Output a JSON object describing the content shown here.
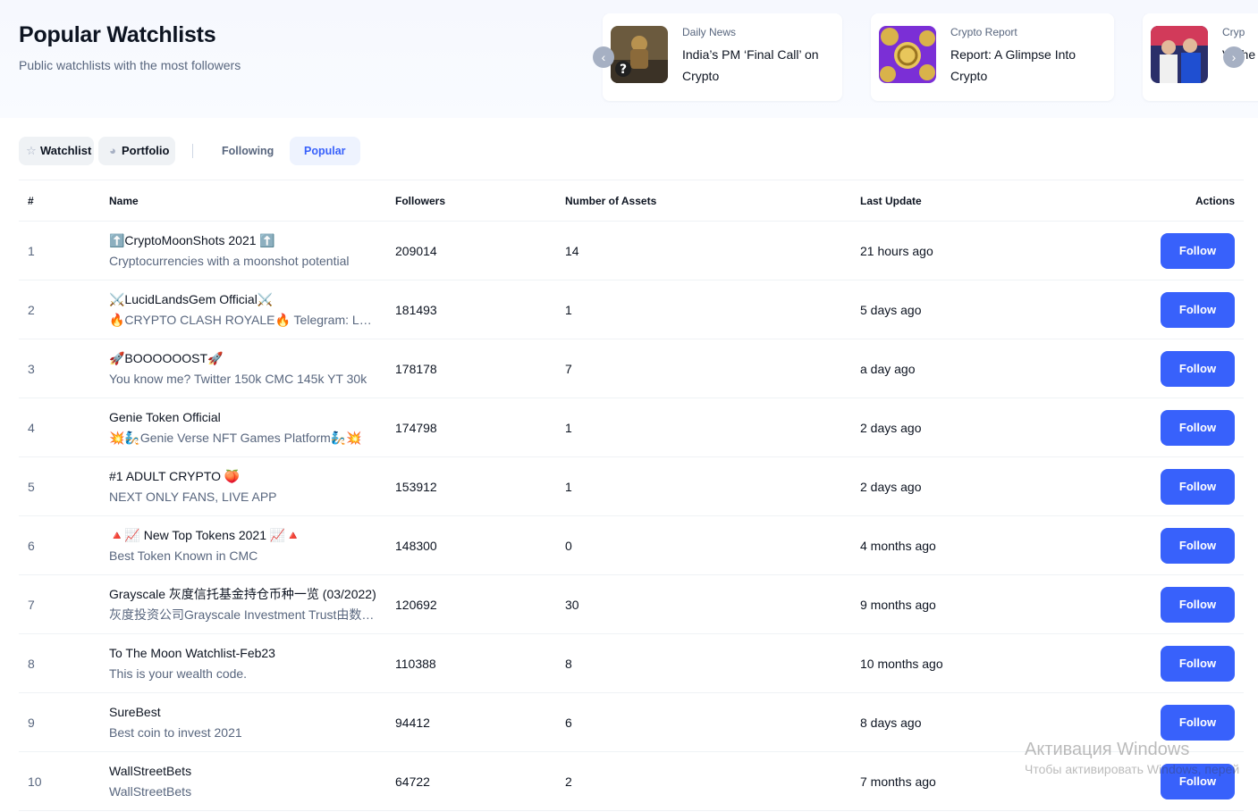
{
  "header": {
    "title": "Popular Watchlists",
    "subtitle": "Public watchlists with the most followers"
  },
  "news": [
    {
      "category": "Daily News",
      "title": "India’s PM ‘Final Call’ on Crypto"
    },
    {
      "category": "Crypto Report",
      "title": "Report: A Glimpse Into Crypto"
    },
    {
      "category": "Cryp",
      "title": "V The"
    }
  ],
  "tabs": {
    "watchlist": "Watchlist",
    "portfolio": "Portfolio",
    "following": "Following",
    "popular": "Popular"
  },
  "table": {
    "headers": {
      "rank": "#",
      "name": "Name",
      "followers": "Followers",
      "assets": "Number of Assets",
      "update": "Last Update",
      "actions": "Actions"
    },
    "follow_label": "Follow",
    "rows": [
      {
        "rank": "1",
        "name": "⬆️CryptoMoonShots 2021 ⬆️",
        "desc": "Cryptocurrencies with a moonshot potential",
        "followers": "209014",
        "assets": "14",
        "update": "21 hours ago"
      },
      {
        "rank": "2",
        "name": "⚔️LucidLandsGem Official⚔️",
        "desc": "🔥CRYPTO CLASH ROYALE🔥 Telegram: LucidLandsGem",
        "followers": "181493",
        "assets": "1",
        "update": "5 days ago"
      },
      {
        "rank": "3",
        "name": "🚀BOOOOOOST🚀",
        "desc": "You know me? Twitter 150k CMC 145k YT 30k",
        "followers": "178178",
        "assets": "7",
        "update": "a day ago"
      },
      {
        "rank": "4",
        "name": "Genie Token Official",
        "desc": "💥🧞Genie Verse NFT Games Platform🧞💥",
        "followers": "174798",
        "assets": "1",
        "update": "2 days ago"
      },
      {
        "rank": "5",
        "name": "#1 ADULT CRYPTO 🍑",
        "desc": "NEXT ONLY FANS, LIVE APP",
        "followers": "153912",
        "assets": "1",
        "update": "2 days ago"
      },
      {
        "rank": "6",
        "name": "🔺📈 New Top Tokens 2021 📈🔺",
        "desc": "Best Token Known in CMC",
        "followers": "148300",
        "assets": "0",
        "update": "4 months ago"
      },
      {
        "rank": "7",
        "name": "Grayscale 灰度信托基金持仓币种一览 (03/2022)",
        "desc": "灰度投资公司Grayscale Investment Trust由数字货币集团",
        "followers": "120692",
        "assets": "30",
        "update": "9 months ago"
      },
      {
        "rank": "8",
        "name": "To The Moon Watchlist-Feb23",
        "desc": "This is your wealth code.",
        "followers": "110388",
        "assets": "8",
        "update": "10 months ago"
      },
      {
        "rank": "9",
        "name": "SureBest",
        "desc": "Best coin to invest 2021",
        "followers": "94412",
        "assets": "6",
        "update": "8 days ago"
      },
      {
        "rank": "10",
        "name": "WallStreetBets",
        "desc": "WallStreetBets",
        "followers": "64722",
        "assets": "2",
        "update": "7 months ago"
      }
    ]
  },
  "watermark": {
    "line1": "Активация Windows",
    "line2": "Чтобы активировать Windows, перей"
  }
}
